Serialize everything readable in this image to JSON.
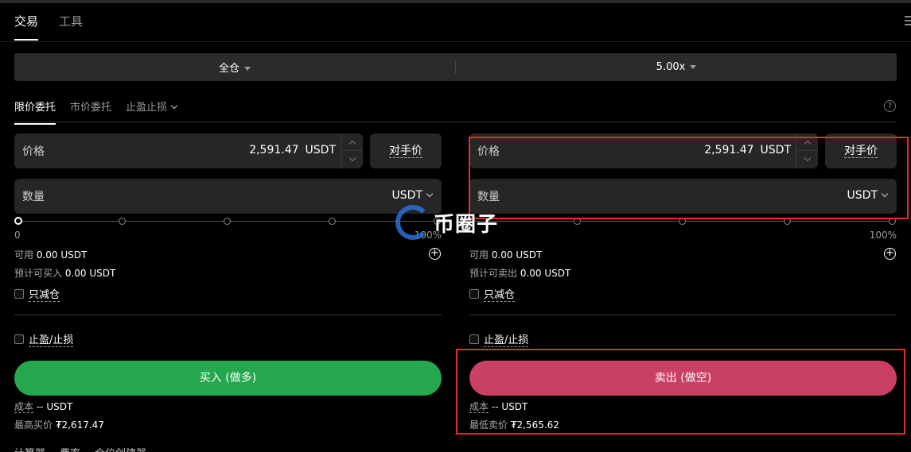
{
  "top_tabs": [
    "交易",
    "工具"
  ],
  "mode": {
    "margin": "全仓",
    "leverage": "5.00x"
  },
  "order_tabs": [
    "限价委托",
    "市价委托",
    "止盈止损"
  ],
  "help_icon": "?",
  "buy": {
    "price_label": "价格",
    "price_value": "2,591.47",
    "price_unit": "USDT",
    "counter_label": "对手价",
    "qty_label": "数量",
    "qty_unit": "USDT",
    "slider_min": "0",
    "slider_max": "100%",
    "slider_percent": 0,
    "avail_label": "可用",
    "avail_value": "0.00 USDT",
    "est_label": "预计可买入",
    "est_value": "0.00 USDT",
    "reduce_only": "只减仓",
    "tpsl": "止盈/止损",
    "action": "买入 (做多)",
    "cost_label": "成本",
    "cost_value": "-- USDT",
    "limit_label": "最高买价",
    "limit_value": "₮2,617.47"
  },
  "sell": {
    "price_label": "价格",
    "price_value": "2,591.47",
    "price_unit": "USDT",
    "counter_label": "对手价",
    "qty_label": "数量",
    "qty_unit": "USDT",
    "slider_max": "100%",
    "slider_percent": 0,
    "avail_label": "可用",
    "avail_value": "0.00 USDT",
    "est_label": "预计可卖出",
    "est_value": "0.00 USDT",
    "reduce_only": "只减仓",
    "tpsl": "止盈/止损",
    "action": "卖出 (做空)",
    "cost_label": "成本",
    "cost_value": "-- USDT",
    "limit_label": "最低卖价",
    "limit_value": "₮2,565.62"
  },
  "tools": [
    "计算器",
    "费率",
    "仓位创建器"
  ],
  "watermark": "币圈子",
  "colors": {
    "buy": "#25a750",
    "sell": "#ca3f64",
    "highlight": "#e0302a"
  }
}
